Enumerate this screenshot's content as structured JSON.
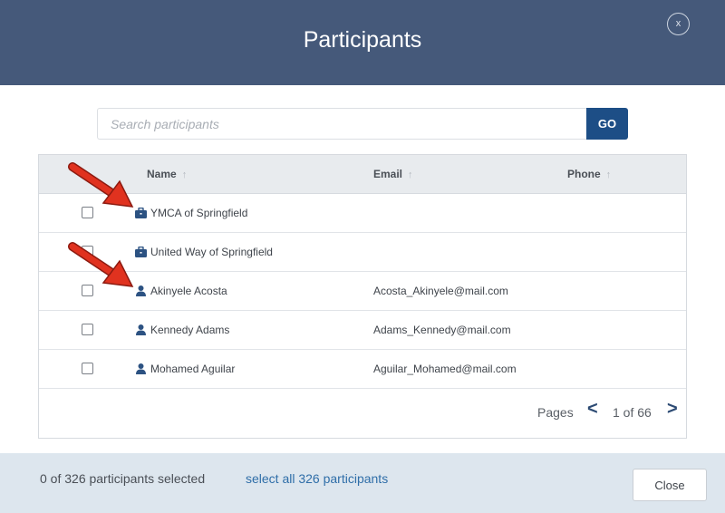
{
  "header": {
    "title": "Participants",
    "close_label": "x"
  },
  "search": {
    "placeholder": "Search participants",
    "value": "",
    "go_label": "GO"
  },
  "table": {
    "columns": [
      {
        "label": "Name",
        "sort_icon": "sort-arrow-up-icon"
      },
      {
        "label": "Email",
        "sort_icon": "sort-arrow-up-icon"
      },
      {
        "label": "Phone",
        "sort_icon": "sort-arrow-up-icon"
      }
    ],
    "rows": [
      {
        "type": "organization",
        "icon": "briefcase-icon",
        "name": "YMCA of Springfield",
        "email": "",
        "phone": "",
        "checked": false
      },
      {
        "type": "organization",
        "icon": "briefcase-icon",
        "name": "United Way of Springfield",
        "email": "",
        "phone": "",
        "checked": false
      },
      {
        "type": "person",
        "icon": "user-icon",
        "name": "Akinyele Acosta",
        "email": "Acosta_Akinyele@mail.com",
        "phone": "",
        "checked": false
      },
      {
        "type": "person",
        "icon": "user-icon",
        "name": "Kennedy Adams",
        "email": "Adams_Kennedy@mail.com",
        "phone": "",
        "checked": false
      },
      {
        "type": "person",
        "icon": "user-icon",
        "name": "Mohamed Aguilar",
        "email": "Aguilar_Mohamed@mail.com",
        "phone": "",
        "checked": false
      }
    ]
  },
  "pagination": {
    "pages_label": "Pages",
    "prev": "<",
    "current": "1 of 66",
    "next": ">"
  },
  "footer": {
    "selected_count": "0 of 326 participants selected",
    "select_all": "select all 326 participants",
    "close_label": "Close"
  },
  "colors": {
    "header_bg": "#45597a",
    "go_button": "#1d4e86",
    "icon_blue": "#2c5282",
    "link_blue": "#2f6ea8",
    "annotation_arrow": "#e0321f"
  }
}
